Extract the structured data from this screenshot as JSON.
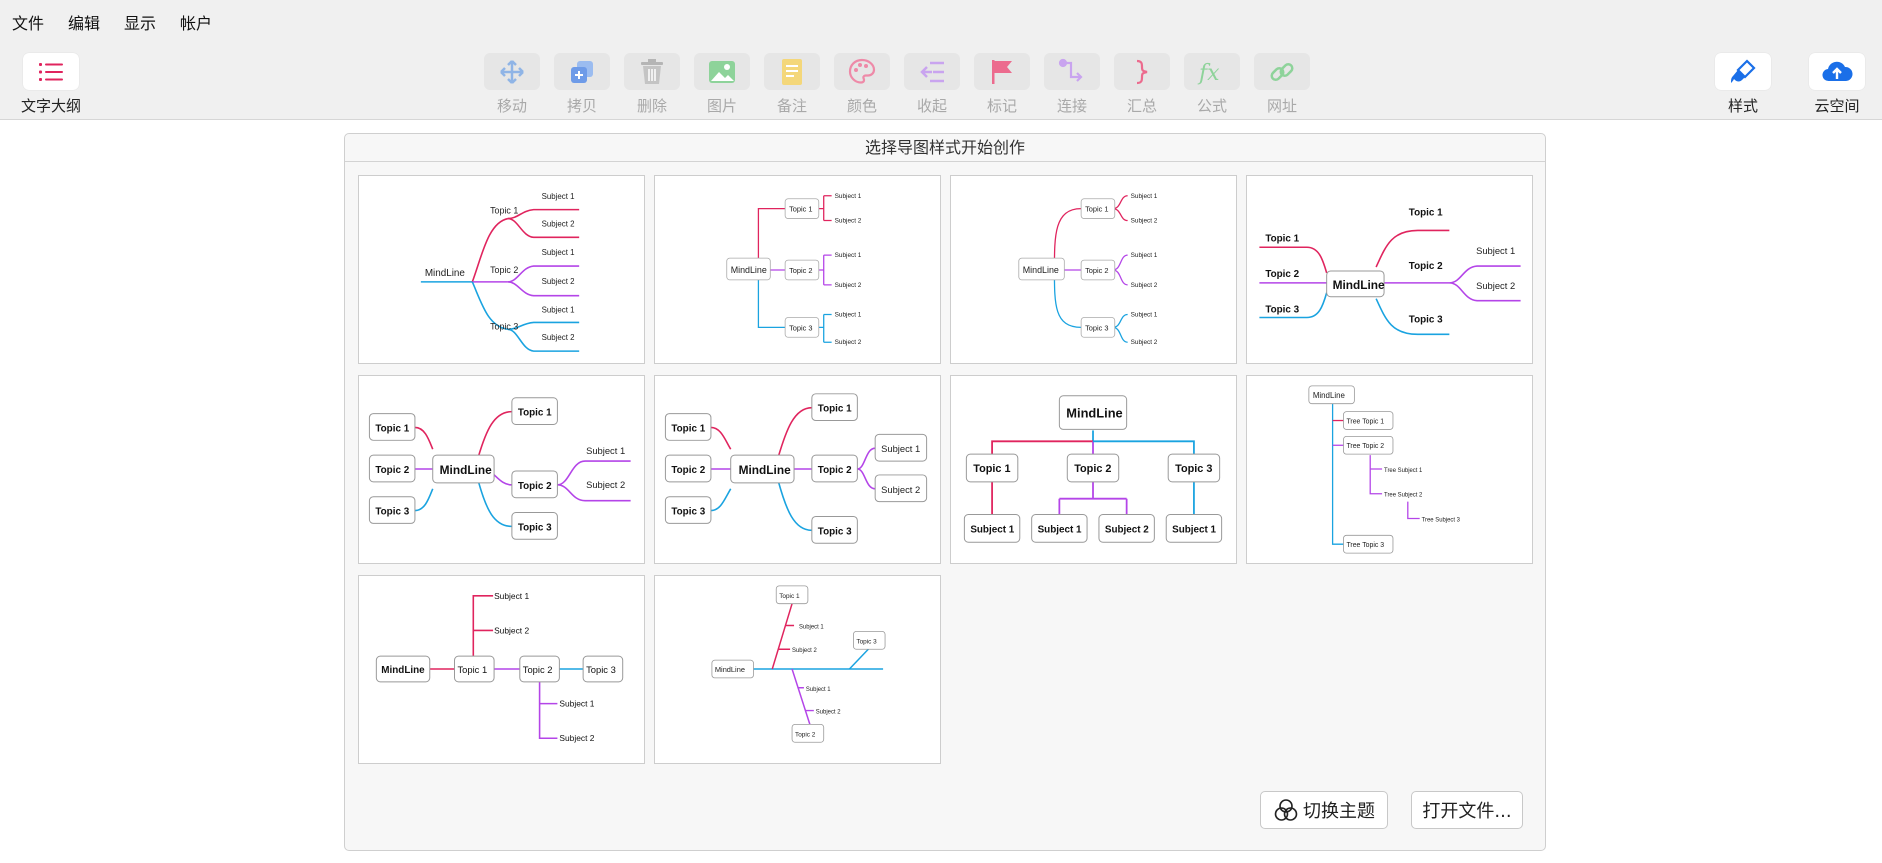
{
  "menu": [
    "文件",
    "编辑",
    "显示",
    "帐户"
  ],
  "toolbar": {
    "outline": "文字大纲",
    "tools": [
      "移动",
      "拷贝",
      "删除",
      "图片",
      "备注",
      "颜色",
      "收起",
      "标记",
      "连接",
      "汇总",
      "公式",
      "网址"
    ],
    "style": "样式",
    "cloud": "云空间"
  },
  "panel": {
    "title": "选择导图样式开始创作",
    "switch_theme": "切换主题",
    "open_file": "打开文件..."
  },
  "labels": {
    "mindline": "MindLine",
    "topic1": "Topic 1",
    "topic2": "Topic 2",
    "topic3": "Topic 3",
    "subject1": "Subject 1",
    "subject2": "Subject 2",
    "tree_topic1": "Tree Topic 1",
    "tree_topic2": "Tree Topic 2",
    "tree_topic3": "Tree Topic 3",
    "tree_subject1": "Tree Subject 1",
    "tree_subject2": "Tree Subject 2",
    "tree_subject3": "Tree Subject 3"
  },
  "colors": {
    "pink": "#e0245e",
    "purple": "#b445e8",
    "blue": "#1aa3e0",
    "accent": "#1a6fe8",
    "outline_icon": "#e0245e"
  }
}
